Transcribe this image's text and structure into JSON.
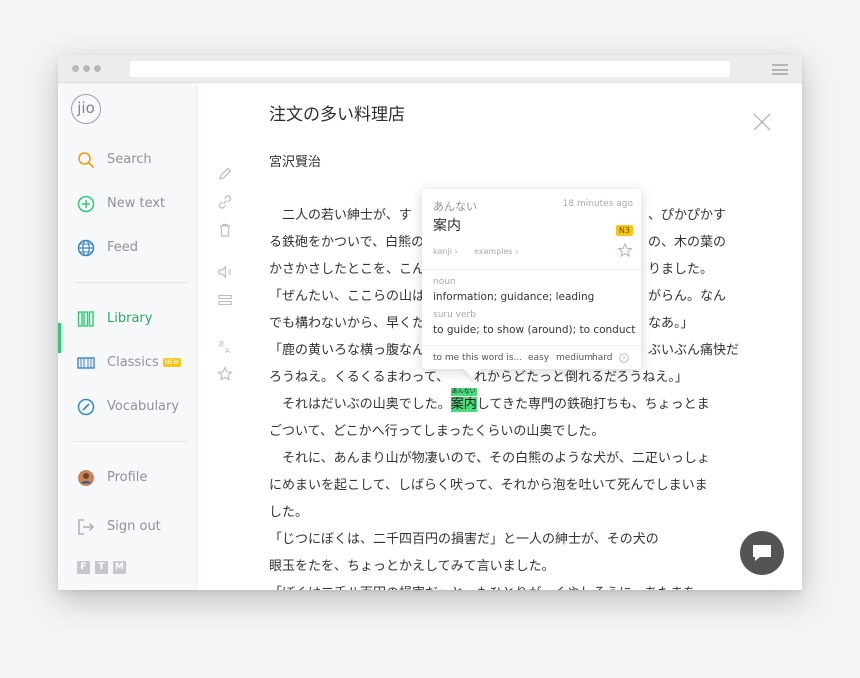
{
  "sidebar": {
    "logo": "jio",
    "items": [
      {
        "label": "Search",
        "icon": "search-icon"
      },
      {
        "label": "New text",
        "icon": "plus-circle-icon"
      },
      {
        "label": "Feed",
        "icon": "globe-icon"
      },
      {
        "label": "Library",
        "icon": "books-icon"
      },
      {
        "label": "Classics",
        "icon": "classics-icon",
        "badge": "NEW"
      },
      {
        "label": "Vocabulary",
        "icon": "compass-icon"
      },
      {
        "label": "Profile",
        "icon": "avatar"
      },
      {
        "label": "Sign out",
        "icon": "sign-out-icon"
      }
    ],
    "active_item": "Library",
    "social": [
      "F",
      "T",
      "M"
    ]
  },
  "document": {
    "title": "注文の多い料理店",
    "author": "宮沢賢治",
    "lines": [
      "　二人の若い紳士が、す",
      "る鉄砲をかついで、白熊の",
      "かさかさしたとこを、こん",
      "「ぜんたい、ここらの山は",
      "でも構わないから、早くた",
      "「鹿の黄いろな横っ腹なん",
      "ろうねえ。くるくるまわって、"
    ],
    "lines_right": [
      "、ぴかぴかす",
      "の、木の葉の",
      "りました。",
      "がらん。なん",
      "なあ。」",
      "ぶいぶん痛快だ",
      "れからどたっと倒れるだろうねえ。」"
    ],
    "highlight_line": {
      "before": "　それはだいぶの山奥でした。",
      "word": "案内",
      "ruby": "あんない",
      "after": "してきた専門の鉄砲打ちも、ちょっとま"
    },
    "lines_after": [
      "ごついて、どこかへ行ってしまったくらいの山奥でした。",
      "　それに、あんまり山が物凄いので、その白熊のような犬が、二疋いっしょ",
      "にめまいを起こして、しばらく吠って、それから泡を吐いて死んでしまいま",
      "した。",
      "「じつにぼくは、二千四百円の損害だ」と一人の紳士が、その犬の",
      "眼玉をたを、ちょっとかえしてみて言いました。",
      "「ぼくは二千八百円の損害だ」と、もひとりが、くやしそうに、あたまを"
    ]
  },
  "popup": {
    "reading": "あんない",
    "time": "18 minutes ago",
    "word": "案内",
    "jlpt": "N3",
    "links": [
      "kanji",
      "examples"
    ],
    "pos1": "noun",
    "def1": "information; guidance; leading",
    "pos2": "suru verb",
    "def2": "to guide; to show (around); to conduct",
    "difficulty_prompt": "to me this word is...",
    "difficulty_options": [
      "easy",
      "medium",
      "hard"
    ]
  },
  "colors": {
    "accent": "#2ecc71",
    "highlight": "#4cd97b",
    "badge": "#f5c518",
    "chat": "#545454"
  }
}
